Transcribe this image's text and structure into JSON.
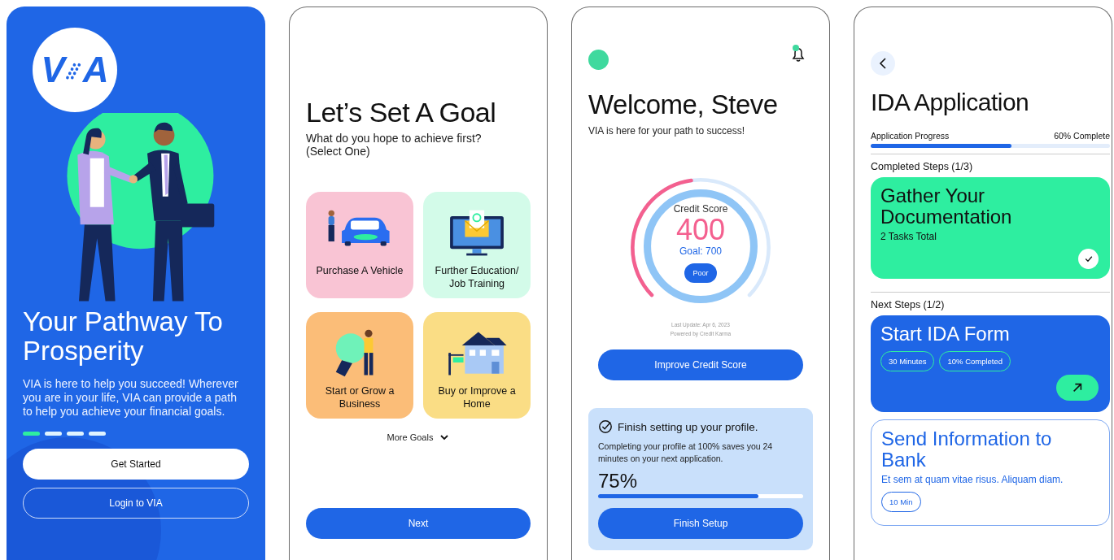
{
  "welcome_screen": {
    "logo_left": "V",
    "logo_right": "A",
    "title": "Your Pathway To Prosperity",
    "description": "VIA is here to help you succeed! Wherever you are in your life, VIA can provide a path to help you achieve your financial goals.",
    "pages": [
      {
        "selected": true
      },
      {
        "selected": false
      },
      {
        "selected": false
      },
      {
        "selected": false
      }
    ],
    "primary_button": "Get Started",
    "secondary_button": "Login to VIA"
  },
  "goal_screen": {
    "title": "Let’s Set A Goal",
    "subtitle_lines": [
      "What do you hope to achieve first?",
      "(Select One)"
    ],
    "goals": [
      {
        "kind": "vehicle",
        "label": "Purchase A Vehicle",
        "color": "#f9c4d4"
      },
      {
        "kind": "education",
        "label": "Further Education/ Job Training",
        "color": "#d3fbe9"
      },
      {
        "kind": "business",
        "label": "Start or Grow a Business",
        "color": "#fbbd78"
      },
      {
        "kind": "home",
        "label": "Buy or Improve a Home",
        "color": "#fadd85"
      }
    ],
    "more_goals": "More Goals",
    "next_button": "Next"
  },
  "home_screen": {
    "notification": true,
    "title": "Welcome, Steve",
    "subtitle": "VIA is here for your path to success!",
    "credit": {
      "label": "Credit Score",
      "score": "400",
      "goal": "Goal: 700",
      "rating": "Poor",
      "updated": "Last Update: Apr 6, 2023",
      "source": "Powered by Credit Karma"
    },
    "improve_button": "Improve Credit Score",
    "profile_card": {
      "title": "Finish setting up your profile.",
      "description": "Completing your profile at 100% saves you 24 minutes on your next application.",
      "percent": "75%",
      "level": 0.78,
      "button": "Finish Setup"
    }
  },
  "application_screen": {
    "title": "IDA Application",
    "progress_label": "Application Progress",
    "progress_text": "60% Complete",
    "level": 0.59,
    "completed_heading": "Completed Steps (1/3)",
    "next_heading": "Next Steps (1/2)",
    "steps": [
      {
        "kind": "completed",
        "title": "Gather Your Documentation",
        "detail": "2 Tasks Total"
      },
      {
        "kind": "current",
        "title": "Start IDA Form",
        "tags": [
          "30 Minutes",
          "10% Completed"
        ]
      },
      {
        "kind": "upcoming",
        "title": "Send Information to Bank",
        "detail": "Et sem at quam vitae risus. Aliquam diam.",
        "tags": [
          "10 Min"
        ]
      }
    ]
  }
}
